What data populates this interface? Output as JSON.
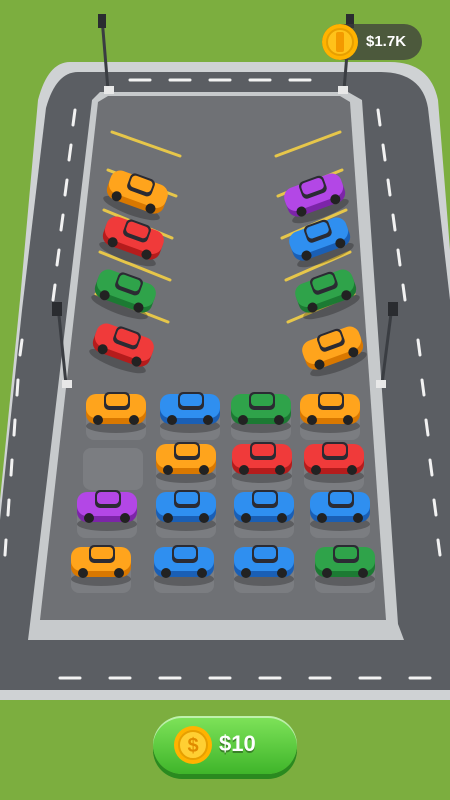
{
  "hud": {
    "coin_balance": "$1.7K",
    "coin_icon": "dollar-coin-icon"
  },
  "buy_button": {
    "label": "$10",
    "icon": "dollar-coin-icon"
  },
  "parking_lot": {
    "left_spots": [
      "orange",
      "red",
      "green",
      "red"
    ],
    "right_spots": [
      "purple",
      "blue",
      "green",
      "orange"
    ]
  },
  "garage_grid": {
    "rows": [
      [
        "orange",
        "blue",
        "green",
        "orange"
      ],
      [
        "empty",
        "orange",
        "red",
        "red"
      ],
      [
        "purple",
        "blue",
        "blue",
        "blue"
      ],
      [
        "orange",
        "blue",
        "blue",
        "green"
      ]
    ]
  },
  "colors": {
    "grass": "#7cae3f",
    "road": "#5b5e63",
    "lot": "#6f7175",
    "curb": "#cfd2d4",
    "parking_line": "#e6c64a",
    "coin": "#ffc21a",
    "button_green": "#4cc232"
  }
}
